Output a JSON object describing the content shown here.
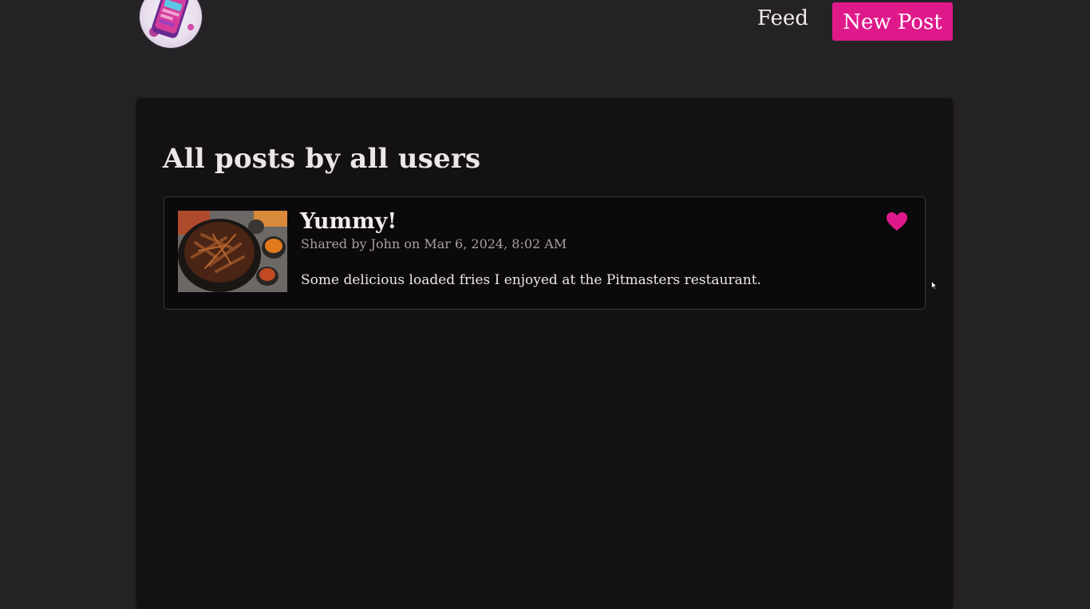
{
  "header": {
    "logo_icon": "phone-logo-icon",
    "nav": {
      "feed_label": "Feed",
      "new_post_label": "New Post"
    }
  },
  "main": {
    "title": "All posts by all users",
    "posts": [
      {
        "title": "Yummy!",
        "meta": "Shared by John on Mar 6, 2024, 8:02 AM",
        "body": "Some delicious loaded fries I enjoyed at the Pitmasters restaurant.",
        "liked": true,
        "image_icon": "loaded-fries-photo"
      }
    ]
  },
  "colors": {
    "background": "#252226",
    "panel": "#131113",
    "card": "#0b090b",
    "accent": "#e0198b",
    "text": "#ede7ea",
    "muted": "#a79fa5"
  }
}
